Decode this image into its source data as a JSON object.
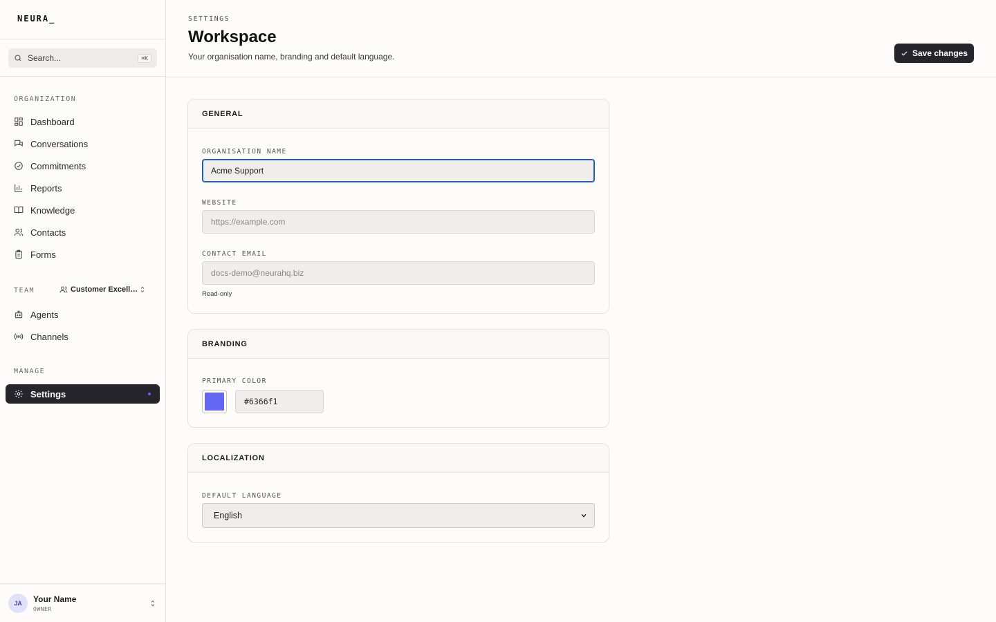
{
  "app": {
    "logo": "NEURA_"
  },
  "search": {
    "placeholder": "Search...",
    "shortcut": "⌘K"
  },
  "sidebar": {
    "sections": {
      "organization": "ORGANIZATION",
      "team": "TEAM",
      "manage": "MANAGE"
    },
    "org_items": [
      {
        "label": "Dashboard",
        "icon": "dashboard-icon"
      },
      {
        "label": "Conversations",
        "icon": "chat-icon"
      },
      {
        "label": "Commitments",
        "icon": "check-circle-icon"
      },
      {
        "label": "Reports",
        "icon": "bar-chart-icon"
      },
      {
        "label": "Knowledge",
        "icon": "book-icon"
      },
      {
        "label": "Contacts",
        "icon": "users-icon"
      },
      {
        "label": "Forms",
        "icon": "clipboard-icon"
      }
    ],
    "team_name": "Customer Excellence",
    "team_items": [
      {
        "label": "Agents",
        "icon": "bot-icon"
      },
      {
        "label": "Channels",
        "icon": "broadcast-icon"
      }
    ],
    "manage_items": [
      {
        "label": "Settings",
        "icon": "gear-icon",
        "active": true
      }
    ]
  },
  "user": {
    "initials": "JA",
    "name": "Your Name",
    "role": "OWNER"
  },
  "header": {
    "eyebrow": "SETTINGS",
    "title": "Workspace",
    "subtitle": "Your organisation name, branding and default language.",
    "save_label": "Save changes"
  },
  "general": {
    "title": "GENERAL",
    "org_name_label": "ORGANISATION NAME",
    "org_name_value": "Acme Support",
    "website_label": "WEBSITE",
    "website_placeholder": "https://example.com",
    "email_label": "CONTACT EMAIL",
    "email_value": "docs-demo@neurahq.biz",
    "email_hint": "Read-only"
  },
  "branding": {
    "title": "BRANDING",
    "primary_color_label": "PRIMARY COLOR",
    "primary_color_value": "#6366f1"
  },
  "localization": {
    "title": "LOCALIZATION",
    "language_label": "DEFAULT LANGUAGE",
    "language_value": "English"
  },
  "colors": {
    "accent": "#6366f1",
    "dark": "#26252b",
    "focus": "#1f5fbf"
  }
}
